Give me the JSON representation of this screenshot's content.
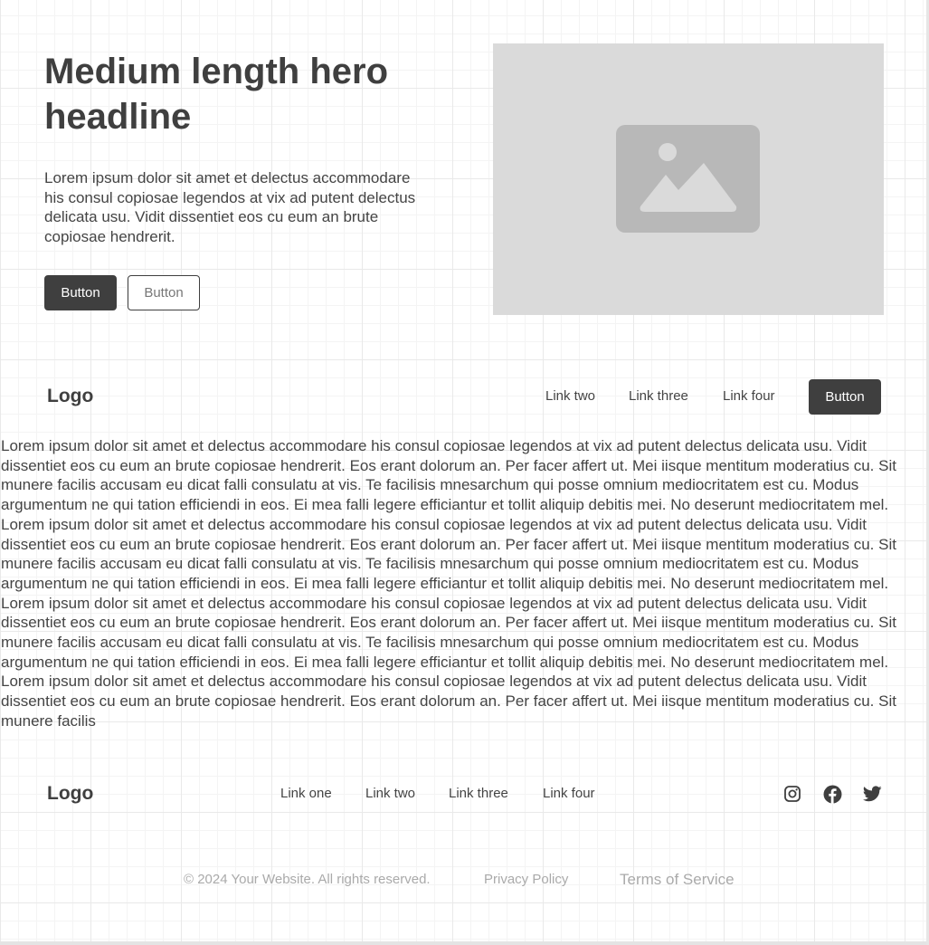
{
  "hero": {
    "title": "Medium length hero headline",
    "text": "Lorem ipsum dolor sit amet et delectus accommodare his consul copiosae legendos at vix ad putent delectus delicata usu. Vidit dissentiet eos cu eum an brute copiosae hendrerit.",
    "primary_button": "Button",
    "secondary_button": "Button",
    "image_icon": "image-placeholder-icon"
  },
  "navbar": {
    "logo": "Logo",
    "links": [
      "Link two",
      "Link three",
      "Link four"
    ],
    "button": "Button"
  },
  "body_text": "Lorem ipsum dolor sit amet et delectus accommodare his consul copiosae legendos at vix ad putent delectus delicata usu. Vidit dissentiet eos cu eum an brute copiosae hendrerit. Eos erant dolorum an. Per facer affert ut. Mei iisque mentitum moderatius cu. Sit munere facilis accusam eu dicat falli consulatu at vis. Te facilisis mnesarchum qui posse omnium mediocritatem est cu. Modus argumentum ne qui tation efficiendi in eos. Ei mea falli legere efficiantur et tollit aliquip debitis mei. No deserunt mediocritatem mel. Lorem ipsum dolor sit amet et delectus accommodare his consul copiosae legendos at vix ad putent delectus delicata usu. Vidit dissentiet eos cu eum an brute copiosae hendrerit. Eos erant dolorum an. Per facer affert ut. Mei iisque mentitum moderatius cu. Sit munere facilis accusam eu dicat falli consulatu at vis. Te facilisis mnesarchum qui posse omnium mediocritatem est cu. Modus argumentum ne qui tation efficiendi in eos. Ei mea falli legere efficiantur et tollit aliquip debitis mei. No deserunt mediocritatem mel. Lorem ipsum dolor sit amet et delectus accommodare his consul copiosae legendos at vix ad putent delectus delicata usu. Vidit dissentiet eos cu eum an brute copiosae hendrerit. Eos erant dolorum an. Per facer affert ut. Mei iisque mentitum moderatius cu. Sit munere facilis accusam eu dicat falli consulatu at vis. Te facilisis mnesarchum qui posse omnium mediocritatem est cu. Modus argumentum ne qui tation efficiendi in eos. Ei mea falli legere efficiantur et tollit aliquip debitis mei. No deserunt mediocritatem mel. Lorem ipsum dolor sit amet et delectus accommodare his consul copiosae legendos at vix ad putent delectus delicata usu. Vidit dissentiet eos cu eum an brute copiosae hendrerit. Eos erant dolorum an. Per facer affert ut. Mei iisque mentitum moderatius cu. Sit munere facilis",
  "footer": {
    "logo": "Logo",
    "links": [
      "Link one",
      "Link two",
      "Link three",
      "Link four"
    ],
    "social_icons": [
      "instagram-icon",
      "facebook-icon",
      "twitter-icon"
    ],
    "copyright": "© 2024 Your Website. All rights reserved.",
    "privacy": "Privacy Policy",
    "terms": "Terms of Service"
  },
  "colors": {
    "primary": "#3f3f3f",
    "placeholder_bg": "#dadada",
    "placeholder_icon": "#b8b8b8",
    "muted_text": "#aaaaaa"
  }
}
